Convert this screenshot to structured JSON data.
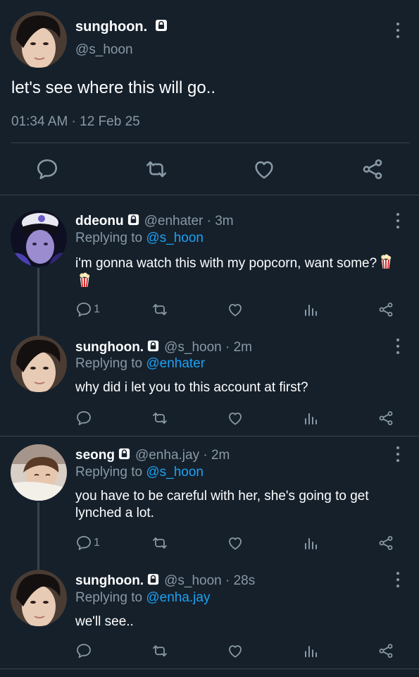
{
  "main_tweet": {
    "name": "sunghoon.",
    "handle": "@s_hoon",
    "text": "let's see where this will go..",
    "timestamp": "01:34 AM · 12 Feb 25",
    "icons": [
      "reply-icon",
      "retweet-icon",
      "like-icon",
      "share-icon"
    ]
  },
  "replies": [
    {
      "name": "ddeonu",
      "meta": "@enhater · 3m",
      "replying_prefix": "Replying to",
      "replying_to": "@s_hoon",
      "text": "i'm gonna watch this with my popcorn, want some?",
      "text_emoji": "popcorn-emoji x2",
      "reply_count": "1"
    },
    {
      "name": "sunghoon.",
      "meta": "@s_hoon · 2m",
      "replying_prefix": "Replying to",
      "replying_to": "@enhater",
      "text": "why did i let you to this account at first?",
      "reply_count": ""
    },
    {
      "name": "seong",
      "meta": "@enha.jay · 2m",
      "replying_prefix": "Replying to",
      "replying_to": "@s_hoon",
      "text": "you have to be careful with her, she's going to get lynched a lot.",
      "reply_count": "1"
    },
    {
      "name": "sunghoon.",
      "meta": "@s_hoon · 28s",
      "replying_prefix": "Replying to",
      "replying_to": "@enha.jay",
      "text": "we'll see..",
      "reply_count": ""
    }
  ],
  "colors": {
    "background": "#15202b",
    "secondary_text": "#8899a6",
    "link": "#1da1f2",
    "divider": "#38444d"
  }
}
